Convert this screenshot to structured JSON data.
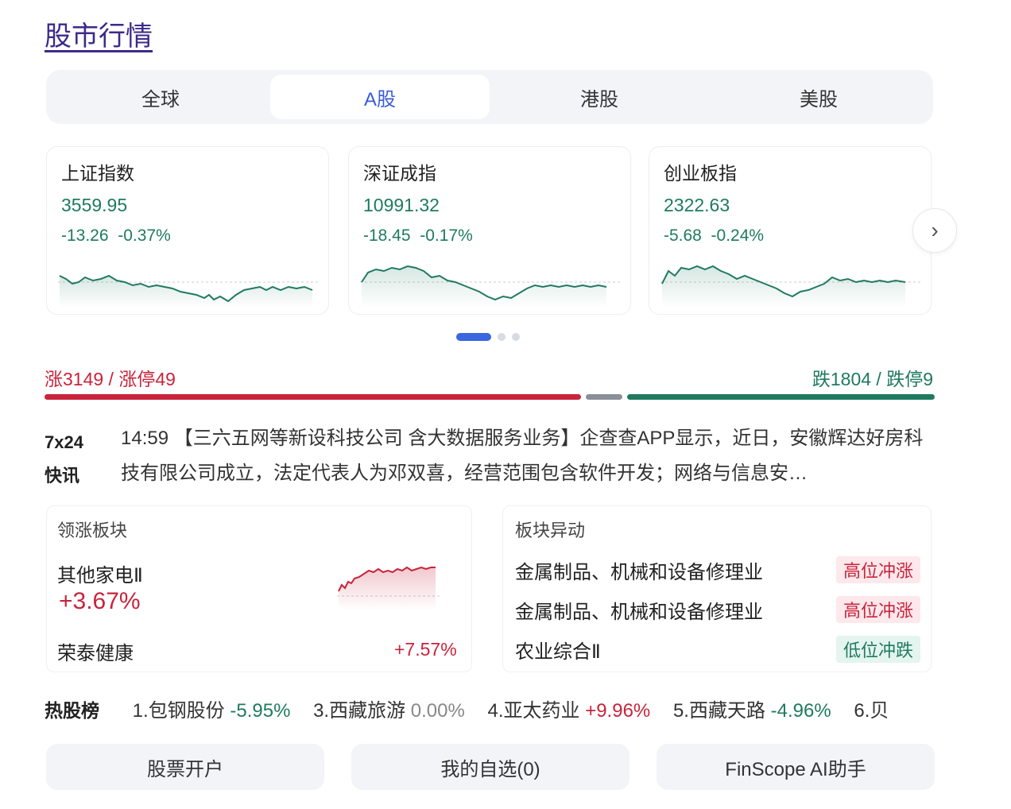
{
  "title": "股市行情",
  "tabs": [
    {
      "label": "全球",
      "active": false
    },
    {
      "label": "A股",
      "active": true
    },
    {
      "label": "港股",
      "active": false
    },
    {
      "label": "美股",
      "active": false
    }
  ],
  "indices": [
    {
      "name": "上证指数",
      "value": "3559.95",
      "change": "-13.26",
      "pct": "-0.37%"
    },
    {
      "name": "深证成指",
      "value": "10991.32",
      "change": "-18.45",
      "pct": "-0.17%"
    },
    {
      "name": "创业板指",
      "value": "2322.63",
      "change": "-5.68",
      "pct": "-0.24%"
    }
  ],
  "carousel": {
    "pages": 3,
    "current": 1
  },
  "breadth": {
    "up_text": "涨3149 / 涨停49",
    "down_text": "跌1804 / 跌停9",
    "up": 3149,
    "down": 1804
  },
  "news": {
    "label_line1": "7x24",
    "label_line2": "快讯",
    "text": "14:59 【三六五网等新设科技公司 含大数据服务业务】企查查APP显示，近日，安徽辉达好房科技有限公司成立，法定代表人为邓双喜，经营范围包含软件开发；网络与信息安…"
  },
  "leading": {
    "title": "领涨板块",
    "sector": "其他家电Ⅱ",
    "sector_pct": "+3.67%",
    "stock": "荣泰健康",
    "stock_pct": "+7.57%"
  },
  "movement": {
    "title": "板块异动",
    "items": [
      {
        "name": "金属制品、机械和设备修理业",
        "tag": "高位冲涨",
        "dir": "up"
      },
      {
        "name": "金属制品、机械和设备修理业",
        "tag": "高位冲涨",
        "dir": "up"
      },
      {
        "name": "农业综合Ⅱ",
        "tag": "低位冲跌",
        "dir": "down"
      }
    ]
  },
  "hot": {
    "label": "热股榜",
    "items": [
      {
        "rank": "1.",
        "name": "包钢股份",
        "pct": "-5.95%",
        "dir": "down"
      },
      {
        "rank": "3.",
        "name": "西藏旅游",
        "pct": "0.00%",
        "dir": "flat"
      },
      {
        "rank": "4.",
        "name": "亚太药业",
        "pct": "+9.96%",
        "dir": "up"
      },
      {
        "rank": "5.",
        "name": "西藏天路",
        "pct": "-4.96%",
        "dir": "down"
      },
      {
        "rank": "6.",
        "name": "贝",
        "pct": "",
        "dir": "flat"
      }
    ]
  },
  "buttons": {
    "open_account": "股票开户",
    "watchlist": "我的自选(0)",
    "ai": "FinScope AI助手"
  },
  "colors": {
    "up": "#c8243b",
    "down": "#1f7a60",
    "accent": "#3a66e0"
  }
}
